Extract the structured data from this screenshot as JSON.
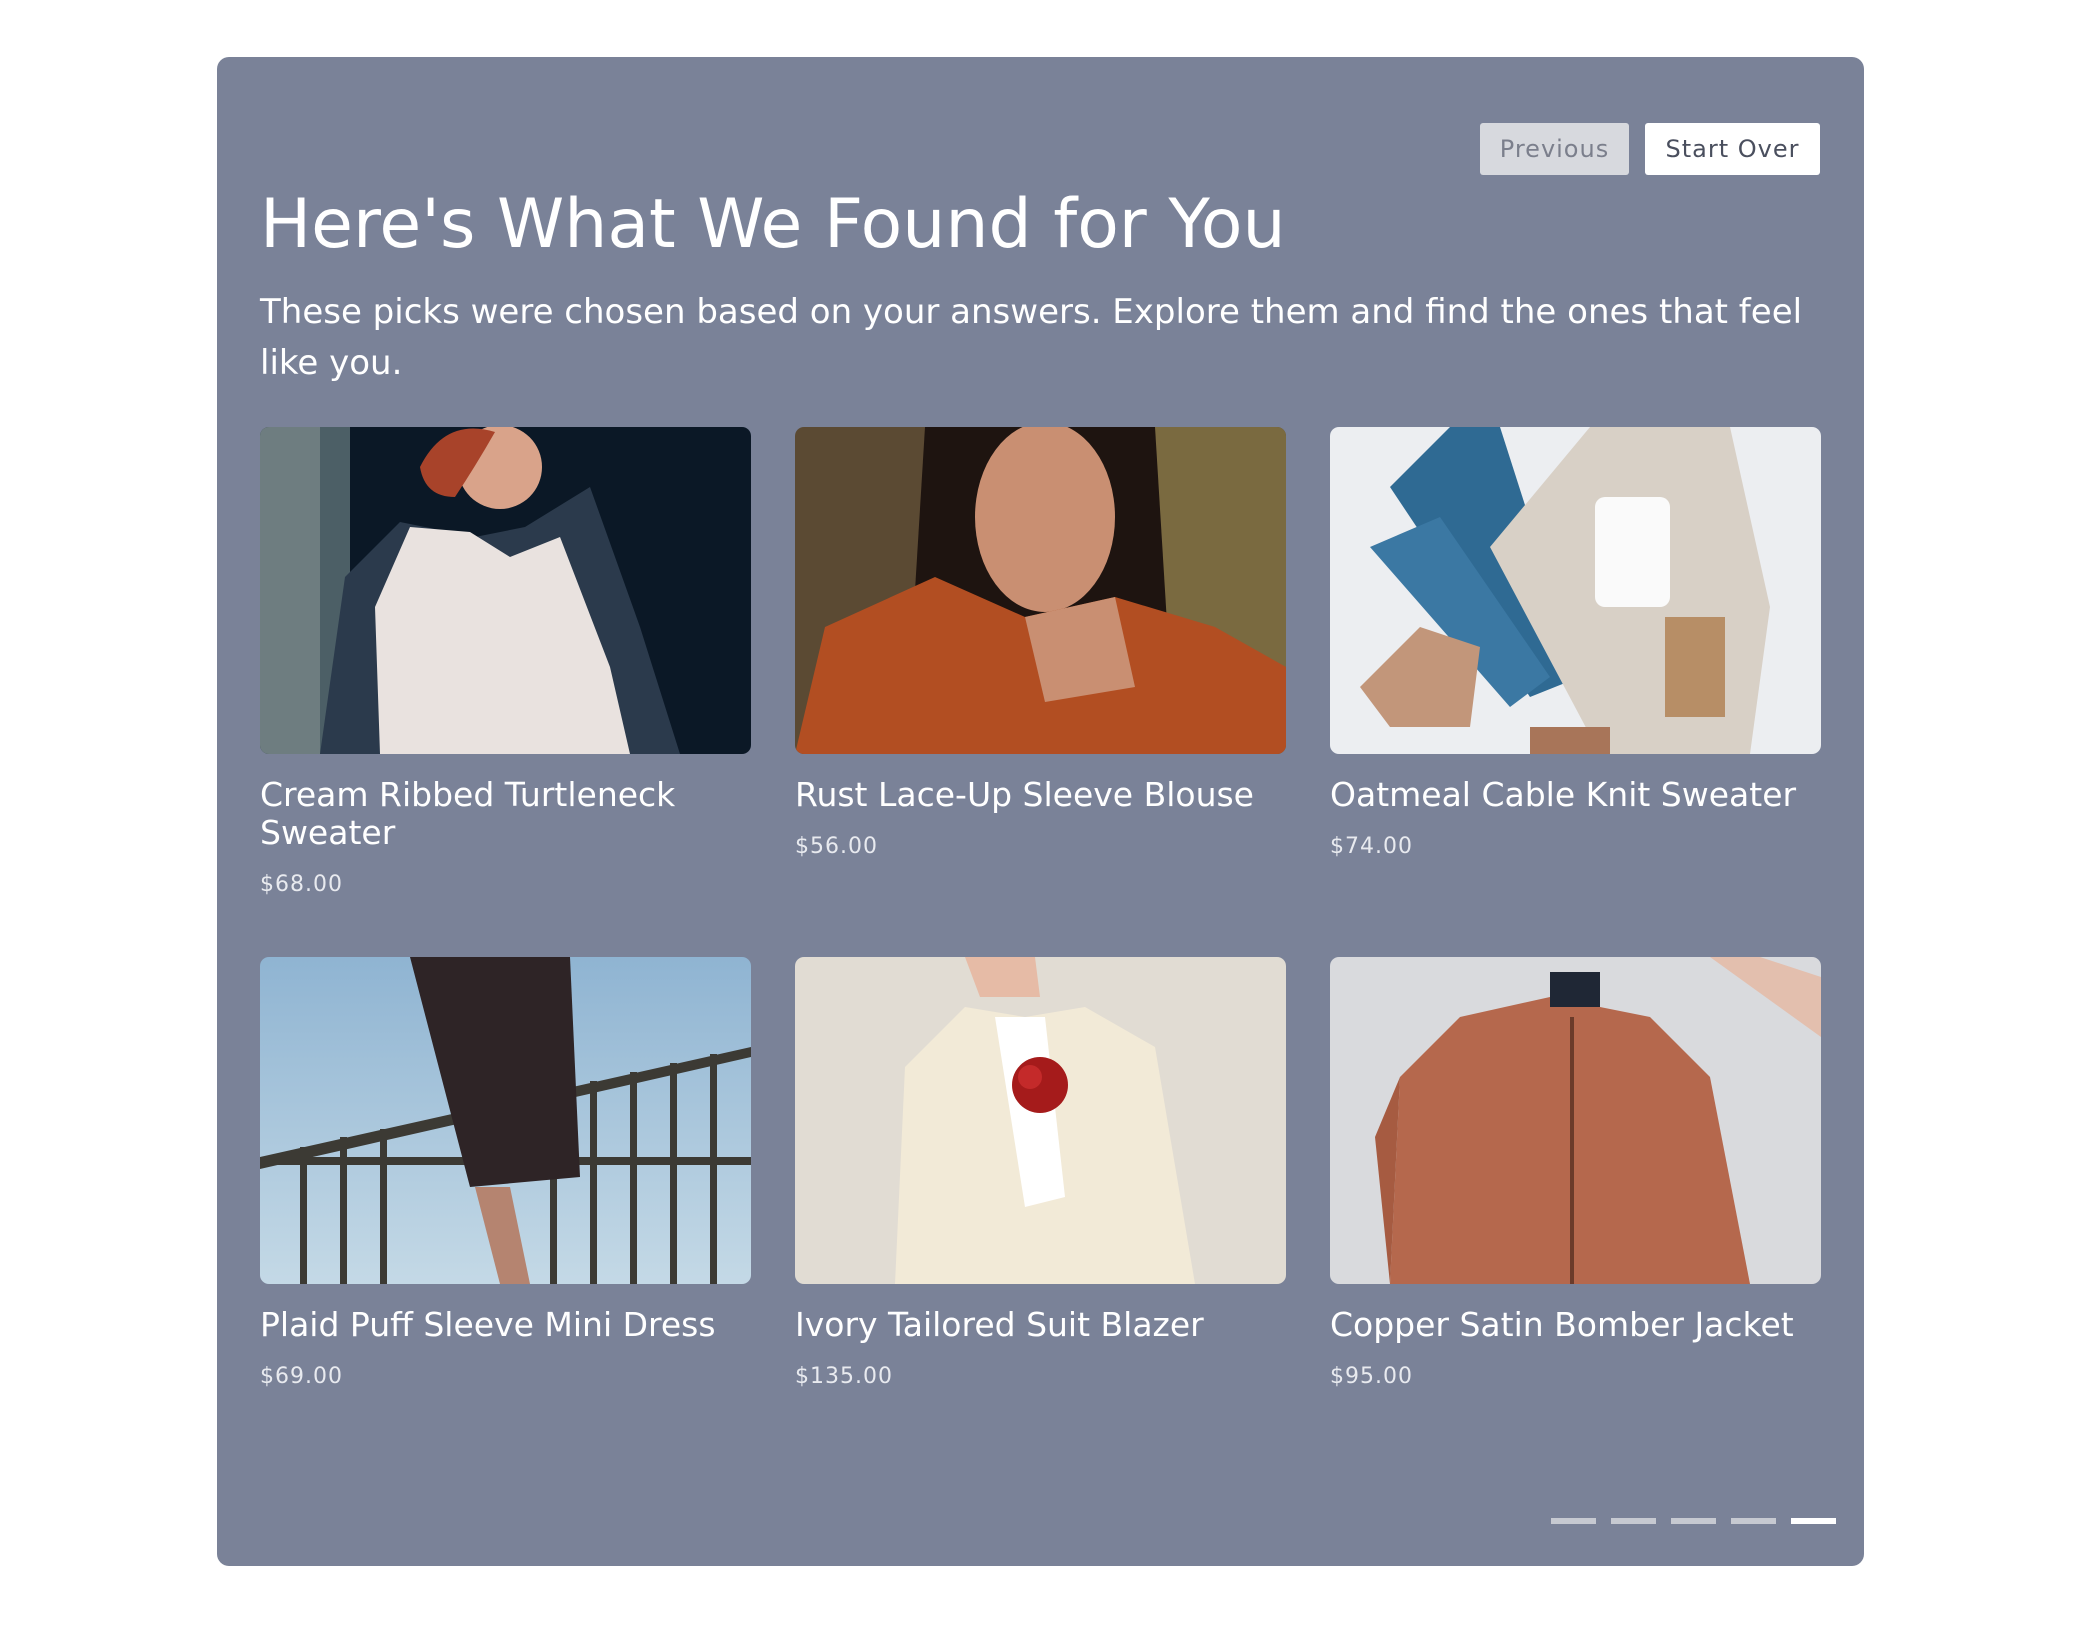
{
  "nav": {
    "previous_label": "Previous",
    "start_over_label": "Start Over"
  },
  "header": {
    "title": "Here's What We Found for You",
    "subtitle": "These picks were chosen based on your answers. Explore them and find the ones that feel like you."
  },
  "products": [
    {
      "name": "Cream Ribbed Turtleneck Sweater",
      "price": "$68.00",
      "image": "woman-white-blouse-dark-coat-photo"
    },
    {
      "name": "Rust Lace-Up Sleeve Blouse",
      "price": "$56.00",
      "image": "woman-rust-blouse-portrait-photo"
    },
    {
      "name": "Oatmeal Cable Knit Sweater",
      "price": "$74.00",
      "image": "flatlay-jeans-sweater-boots-mug-photo"
    },
    {
      "name": "Plaid Puff Sleeve Mini Dress",
      "price": "$69.00",
      "image": "plaid-dress-railing-sky-photo"
    },
    {
      "name": "Ivory Tailored Suit Blazer",
      "price": "$135.00",
      "image": "ivory-blazer-red-rose-photo"
    },
    {
      "name": "Copper Satin Bomber Jacket",
      "price": "$95.00",
      "image": "copper-bomber-jacket-hanger-photo"
    }
  ],
  "pagination": {
    "count": 5,
    "active_index": 4
  },
  "colors": {
    "panel": "#7a8298",
    "text": "#ffffff",
    "dot": "#c6c9d1",
    "dot_active": "#ffffff"
  }
}
